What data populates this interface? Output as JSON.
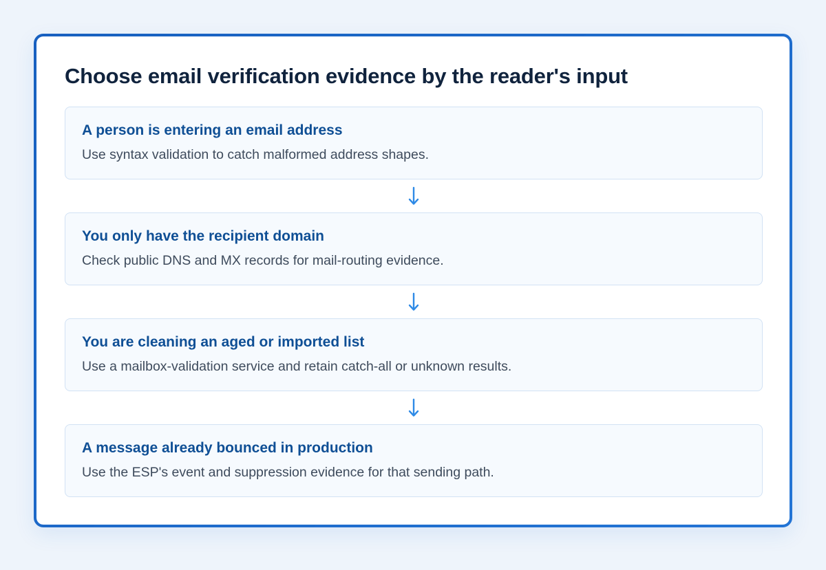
{
  "title": "Choose email verification evidence by the reader's input",
  "steps": [
    {
      "title": "A person is entering an email address",
      "description": "Use syntax validation to catch malformed address shapes."
    },
    {
      "title": "You only have the recipient domain",
      "description": "Check public DNS and MX records for mail-routing evidence."
    },
    {
      "title": "You are cleaning an aged or imported list",
      "description": "Use a mailbox-validation service and retain catch-all or unknown results."
    },
    {
      "title": "A message already bounced in production",
      "description": "Use the ESP's event and suppression evidence for that sending path."
    }
  ],
  "colors": {
    "accent": "#1f6fd1",
    "arrow": "#2e8ae6",
    "step_title": "#0f4f95",
    "step_bg": "#f6fafe",
    "step_border": "#d2e2f4"
  },
  "icons": {
    "connector": "arrow-down-icon"
  }
}
